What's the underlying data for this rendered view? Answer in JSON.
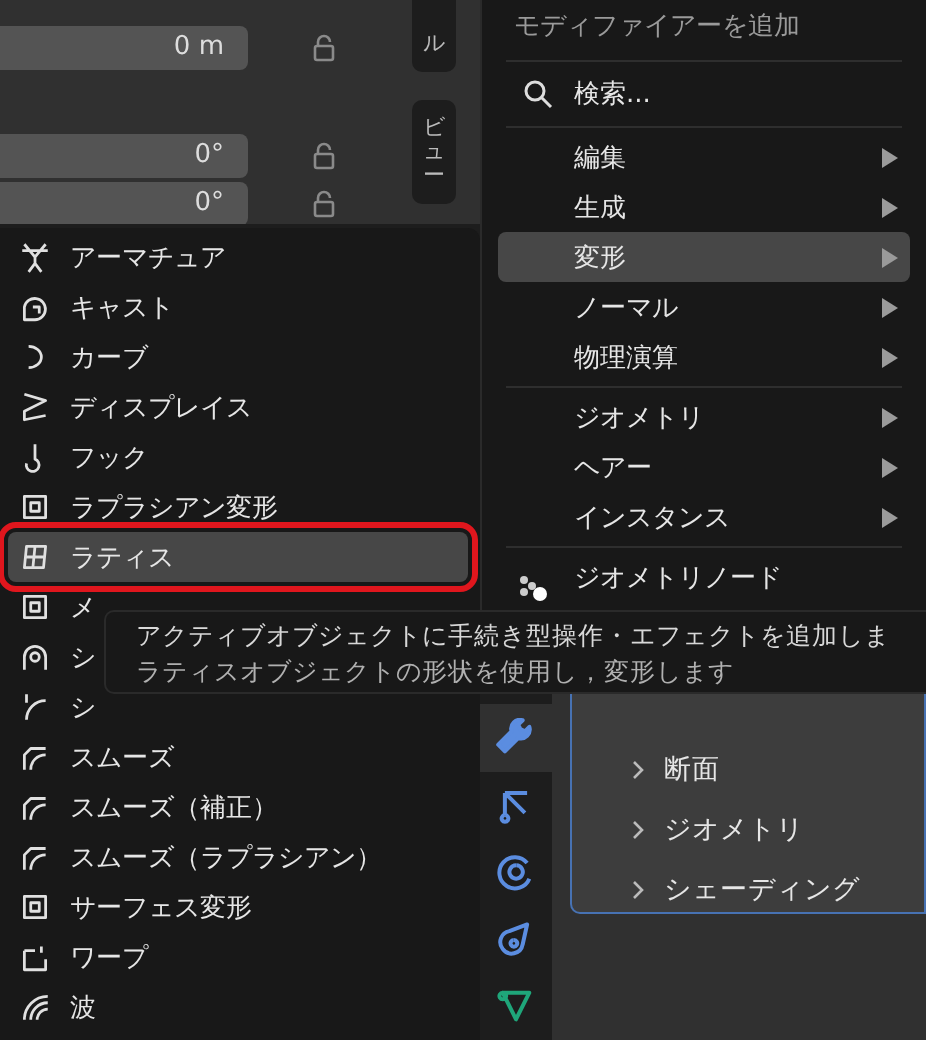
{
  "properties": {
    "rows": [
      {
        "value": "0 m"
      },
      {
        "value": "0°"
      },
      {
        "value": "0°"
      }
    ]
  },
  "sidebar_tabs": [
    {
      "label": "ル"
    },
    {
      "label": "ビュー"
    }
  ],
  "add_modifier_menu": {
    "title": "モディファイアーを追加",
    "search": {
      "placeholder": "検索..."
    },
    "groups": [
      {
        "items": [
          {
            "label": "編集",
            "selected": false,
            "submenu": true
          },
          {
            "label": "生成",
            "selected": false,
            "submenu": true
          },
          {
            "label": "変形",
            "selected": true,
            "submenu": true
          },
          {
            "label": "ノーマル",
            "selected": false,
            "submenu": true
          },
          {
            "label": "物理演算",
            "selected": false,
            "submenu": true
          }
        ]
      },
      {
        "items": [
          {
            "label": "ジオメトリ",
            "selected": false,
            "submenu": true
          },
          {
            "label": "ヘアー",
            "selected": false,
            "submenu": true
          },
          {
            "label": "インスタンス",
            "selected": false,
            "submenu": true
          }
        ]
      },
      {
        "items": [
          {
            "label": "ジオメトリノード",
            "selected": false,
            "submenu": false
          }
        ]
      }
    ]
  },
  "deform_menu": {
    "items": [
      {
        "label": "アーマチュア",
        "selected": false,
        "outlined": false
      },
      {
        "label": "キャスト",
        "selected": false,
        "outlined": false
      },
      {
        "label": "カーブ",
        "selected": false,
        "outlined": false
      },
      {
        "label": "ディスプレイス",
        "selected": false,
        "outlined": false
      },
      {
        "label": "フック",
        "selected": false,
        "outlined": false
      },
      {
        "label": "ラプラシアン変形",
        "selected": false,
        "outlined": false
      },
      {
        "label": "ラティス",
        "selected": true,
        "outlined": true
      },
      {
        "label": "メ",
        "selected": false,
        "outlined": false
      },
      {
        "label": "シ",
        "selected": false,
        "outlined": false
      },
      {
        "label": "シ",
        "selected": false,
        "outlined": false
      },
      {
        "label": "スムーズ",
        "selected": false,
        "outlined": false
      },
      {
        "label": "スムーズ（補正）",
        "selected": false,
        "outlined": false
      },
      {
        "label": "スムーズ（ラプラシアン）",
        "selected": false,
        "outlined": false
      },
      {
        "label": "サーフェス変形",
        "selected": false,
        "outlined": false
      },
      {
        "label": "ワープ",
        "selected": false,
        "outlined": false
      },
      {
        "label": "波",
        "selected": false,
        "outlined": false
      }
    ]
  },
  "tooltip": {
    "lines": [
      "アクティブオブジェクトに手続き型操作・エフェクトを追加しま",
      "ラティスオブジェクトの形状を使用し，変形します"
    ]
  },
  "properties_tabs": [
    {
      "selected": true
    },
    {
      "selected": false
    },
    {
      "selected": false
    },
    {
      "selected": false
    },
    {
      "selected": false
    }
  ],
  "panel": {
    "sections": [
      {
        "label": "断面",
        "expanded": false
      },
      {
        "label": "ジオメトリ",
        "expanded": false
      },
      {
        "label": "シェーディング",
        "expanded": false
      }
    ]
  }
}
